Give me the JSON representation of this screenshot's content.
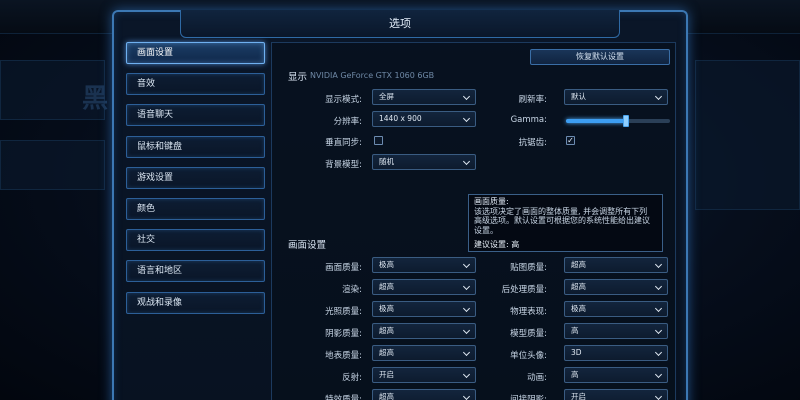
{
  "background": {
    "topbar_left": "",
    "glyph": "黑"
  },
  "window": {
    "title": "选项"
  },
  "sidebar": {
    "items": [
      {
        "label": "画面设置",
        "active": true
      },
      {
        "label": "音效",
        "active": false
      },
      {
        "label": "语音聊天",
        "active": false
      },
      {
        "label": "鼠标和键盘",
        "active": false
      },
      {
        "label": "游戏设置",
        "active": false
      },
      {
        "label": "颜色",
        "active": false
      },
      {
        "label": "社交",
        "active": false
      },
      {
        "label": "语言和地区",
        "active": false
      },
      {
        "label": "观战和录像",
        "active": false
      }
    ]
  },
  "panel": {
    "reset_label": "恢复默认设置",
    "display_title": "显示",
    "gpu_name": "NVIDIA GeForce GTX 1060 6GB",
    "display": {
      "display_mode_label": "显示模式:",
      "display_mode_value": "全屏",
      "resolution_label": "分辨率:",
      "resolution_value": "1440 x 900",
      "vsync_label": "垂直同步:",
      "vsync_checked": false,
      "bg_model_label": "背景模型:",
      "bg_model_value": "随机",
      "refresh_label": "刷新率:",
      "refresh_value": "默认",
      "gamma_label": "Gamma:",
      "gamma_level": 0.58,
      "aa_label": "抗锯齿:",
      "aa_checked": true,
      "aa_mark": "✓"
    },
    "tooltip": {
      "title": "画面质量:",
      "body": "该选项决定了画面的整体质量, 并会调整所有下列\n高级选项。默认设置可根据您的系统性能给出建议\n设置。",
      "recommend": "建议设置: 高"
    },
    "graphics_title": "画面设置",
    "graphics_left": [
      {
        "label": "画面质量:",
        "value": "极高"
      },
      {
        "label": "渲染:",
        "value": "超高"
      },
      {
        "label": "光照质量:",
        "value": "极高"
      },
      {
        "label": "阴影质量:",
        "value": "超高"
      },
      {
        "label": "地表质量:",
        "value": "超高"
      },
      {
        "label": "反射:",
        "value": "开启"
      },
      {
        "label": "特效质量:",
        "value": "超高"
      }
    ],
    "graphics_right": [
      {
        "label": "贴图质量:",
        "value": "超高"
      },
      {
        "label": "后处理质量:",
        "value": "超高"
      },
      {
        "label": "物理表现:",
        "value": "极高"
      },
      {
        "label": "模型质量:",
        "value": "高"
      },
      {
        "label": "单位头像:",
        "value": "3D"
      },
      {
        "label": "动画:",
        "value": "高"
      },
      {
        "label": "间接阴影:",
        "value": "开启"
      }
    ]
  }
}
